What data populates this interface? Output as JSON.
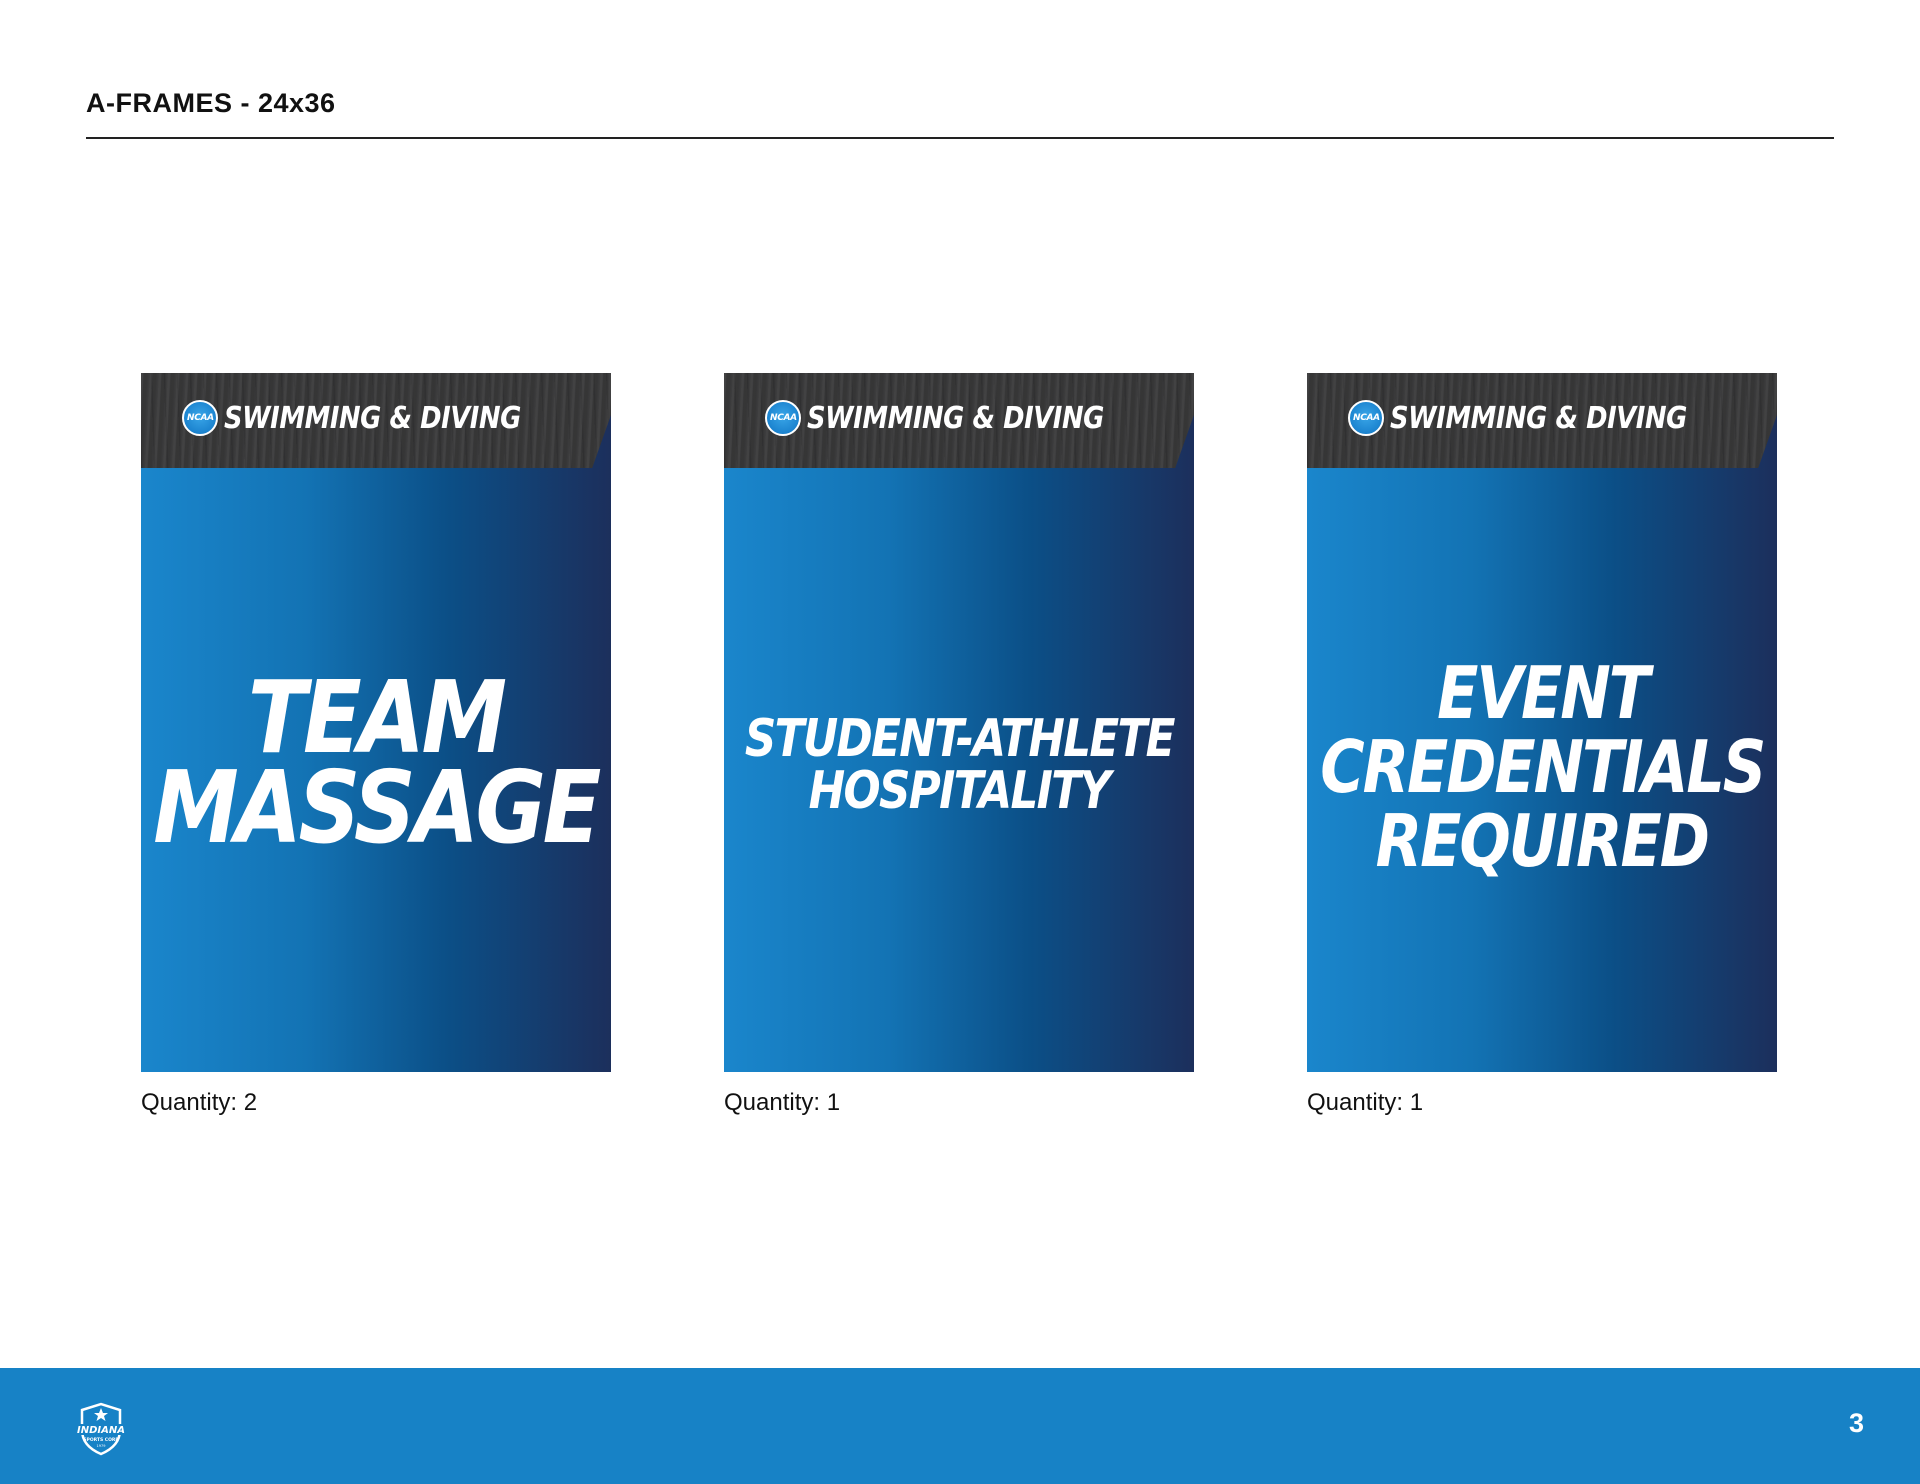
{
  "page": {
    "title": "A-FRAMES - 24x36",
    "page_number": "3"
  },
  "brand": {
    "sign_gradient": [
      "#1a86cc",
      "#0b4f87",
      "#1c2f5c"
    ],
    "footer_color": "#1782c6",
    "header_wood_color": "#3a3a3b"
  },
  "signs": [
    {
      "badge_text": "NCAA",
      "header_text": "SWIMMING & DIVING",
      "message_lines": [
        "TEAM",
        "MASSAGE"
      ],
      "quantity": "Quantity: 2"
    },
    {
      "badge_text": "NCAA",
      "header_text": "SWIMMING & DIVING",
      "message_lines": [
        "STUDENT-ATHLETE",
        "HOSPITALITY"
      ],
      "quantity": "Quantity: 1"
    },
    {
      "badge_text": "NCAA",
      "header_text": "SWIMMING & DIVING",
      "message_lines": [
        "EVENT",
        "CREDENTIALS",
        "REQUIRED"
      ],
      "quantity": "Quantity: 1"
    }
  ],
  "footer": {
    "logo_icon": "indiana-sports-corp-logo",
    "logo_lines": [
      "INDIANA",
      "SPORTS CORP",
      "1979"
    ]
  }
}
